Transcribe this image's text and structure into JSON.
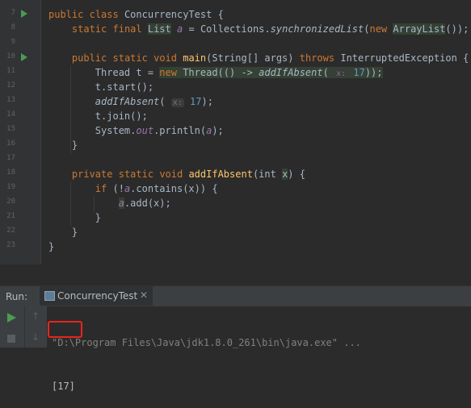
{
  "editor": {
    "lines": [
      {
        "num": "7",
        "run": true,
        "kind": "l7"
      },
      {
        "num": "8",
        "run": false,
        "kind": "l8"
      },
      {
        "num": "9",
        "run": false,
        "kind": "blank"
      },
      {
        "num": "10",
        "run": true,
        "kind": "l10"
      },
      {
        "num": "11",
        "run": false,
        "kind": "l11"
      },
      {
        "num": "12",
        "run": false,
        "kind": "l12"
      },
      {
        "num": "13",
        "run": false,
        "kind": "l13"
      },
      {
        "num": "14",
        "run": false,
        "kind": "l14"
      },
      {
        "num": "15",
        "run": false,
        "kind": "l15"
      },
      {
        "num": "16",
        "run": false,
        "kind": "l16"
      },
      {
        "num": "17",
        "run": false,
        "kind": "blank"
      },
      {
        "num": "18",
        "run": false,
        "kind": "l18"
      },
      {
        "num": "19",
        "run": false,
        "kind": "l19"
      },
      {
        "num": "20",
        "run": false,
        "kind": "l20"
      },
      {
        "num": "21",
        "run": false,
        "kind": "l21"
      },
      {
        "num": "22",
        "run": false,
        "kind": "l22"
      },
      {
        "num": "23",
        "run": false,
        "kind": "l23"
      }
    ],
    "tokens": {
      "public": "public",
      "class": "class",
      "class_name": "ConcurrencyTest",
      "brace_open": "{",
      "brace_close": "}",
      "static": "static",
      "final": "final",
      "list_type": "List",
      "field_a": "a",
      "eq": "=",
      "collections": "Collections.",
      "sync_list": "synchronizedList",
      "new": "new",
      "arraylist": "ArrayList",
      "l8_tail": "());",
      "void": "void",
      "main": "main",
      "main_params": "(String[] args)",
      "throws": "throws",
      "exception": "InterruptedException {",
      "thread_decl": "Thread t = ",
      "thread_ctor": "Thread(() -> ",
      "add_if_absent": "addIfAbsent",
      "paren_open": "(",
      "hint_x": "x:",
      "num_17": "17",
      "l11_tail": "));",
      "l12": "t.start();",
      "l13_tail": ");",
      "l14": "t.join();",
      "sysout": "System.",
      "out": "out",
      "println": ".println(",
      "l15_tail": ");",
      "private": "private",
      "aia_params_pre": "(int ",
      "param_x": "x",
      "aia_params_post": ") {",
      "if_kw": "if",
      "if_pre": " (!",
      "contains": ".contains(x)) {",
      "add": ".add(x);"
    }
  },
  "run": {
    "label": "Run:",
    "tab_label": "ConcurrencyTest",
    "tab_close": "✕",
    "up_arrow": "↑",
    "down_arrow": "↓",
    "command": "\"D:\\Program Files\\Java\\jdk1.8.0_261\\bin\\java.exe\" ...",
    "output": "[17]"
  },
  "icons": {
    "run_gutter": "run-gutter-icon",
    "rerun": "rerun-icon",
    "stop": "stop-icon",
    "scroll_up": "scroll-up-icon",
    "scroll_down": "scroll-down-icon",
    "tab": "java-class-tab-icon",
    "close": "close-icon"
  },
  "colors": {
    "highlight": "#e8261a",
    "keyword": "#cc7832",
    "method": "#ffc66d",
    "field": "#9876aa",
    "number": "#6897bb",
    "run_green": "#499c54"
  }
}
